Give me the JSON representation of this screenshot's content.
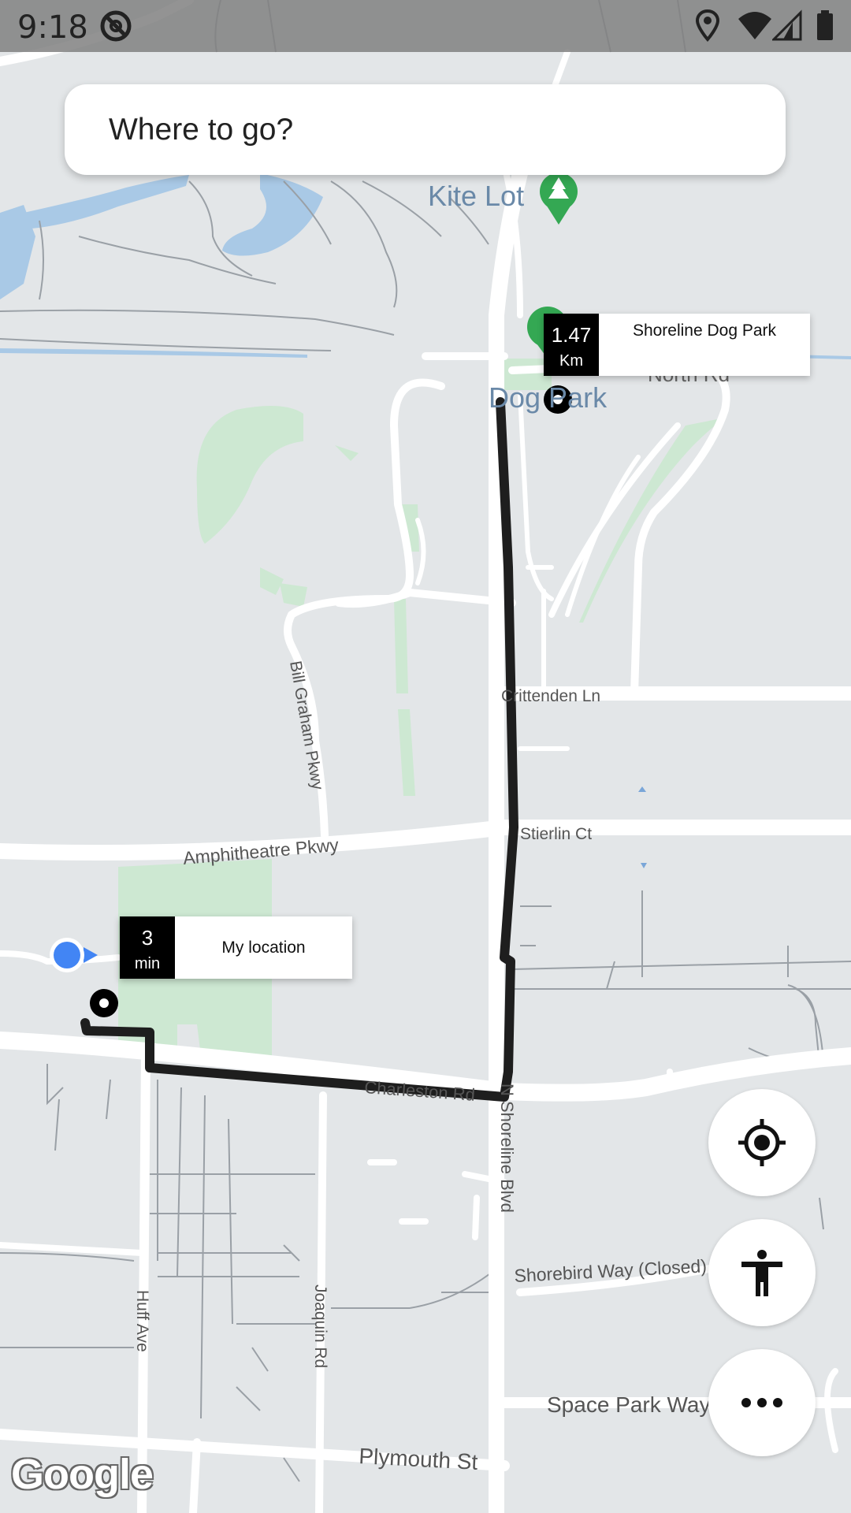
{
  "status_bar": {
    "time": "9:18",
    "icons": [
      "do-not-disturb-icon",
      "location-pin-icon",
      "wifi-icon",
      "cellular-signal-icon",
      "battery-icon"
    ]
  },
  "search": {
    "placeholder": "Where to go?"
  },
  "map": {
    "labels": {
      "kite_lot": "Kite Lot",
      "dog_park": "Dog Park",
      "north_rd": "North Rd",
      "crittenden_ln": "Crittenden Ln",
      "bill_graham_pkwy": "Bill Graham Pkwy",
      "stierlin_ct": "Stierlin Ct",
      "amphitheatre_pkwy": "Amphitheatre Pkwy",
      "charleston_rd": "Charleston Rd",
      "n_shoreline_blvd": "N Shoreline Blvd",
      "shorebird_way": "Shorebird Way (Closed)",
      "huff_ave": "Huff Ave",
      "joaquin_rd": "Joaquin Rd",
      "space_park_way": "Space Park Way",
      "plymouth_st": "Plymouth St"
    },
    "colors": {
      "background": "#e3e6e8",
      "road": "#ffffff",
      "minor_road": "#9aa0a6",
      "park": "#cde8d2",
      "water": "#a9c9e6",
      "route": "#1e1e1e",
      "my_location": "#4285f4",
      "park_marker": "#34a853"
    }
  },
  "destination_callout": {
    "distance_value": "1.47",
    "distance_unit": "Km",
    "label": "Shoreline Dog Park"
  },
  "origin_callout": {
    "time_value": "3",
    "time_unit": "min",
    "label": "My location"
  },
  "controls": {
    "recenter_icon": "my-location-crosshair-icon",
    "accessibility_icon": "accessibility-icon",
    "more_icon": "more-horizontal-icon"
  },
  "attribution": {
    "logo_text": "Google"
  }
}
